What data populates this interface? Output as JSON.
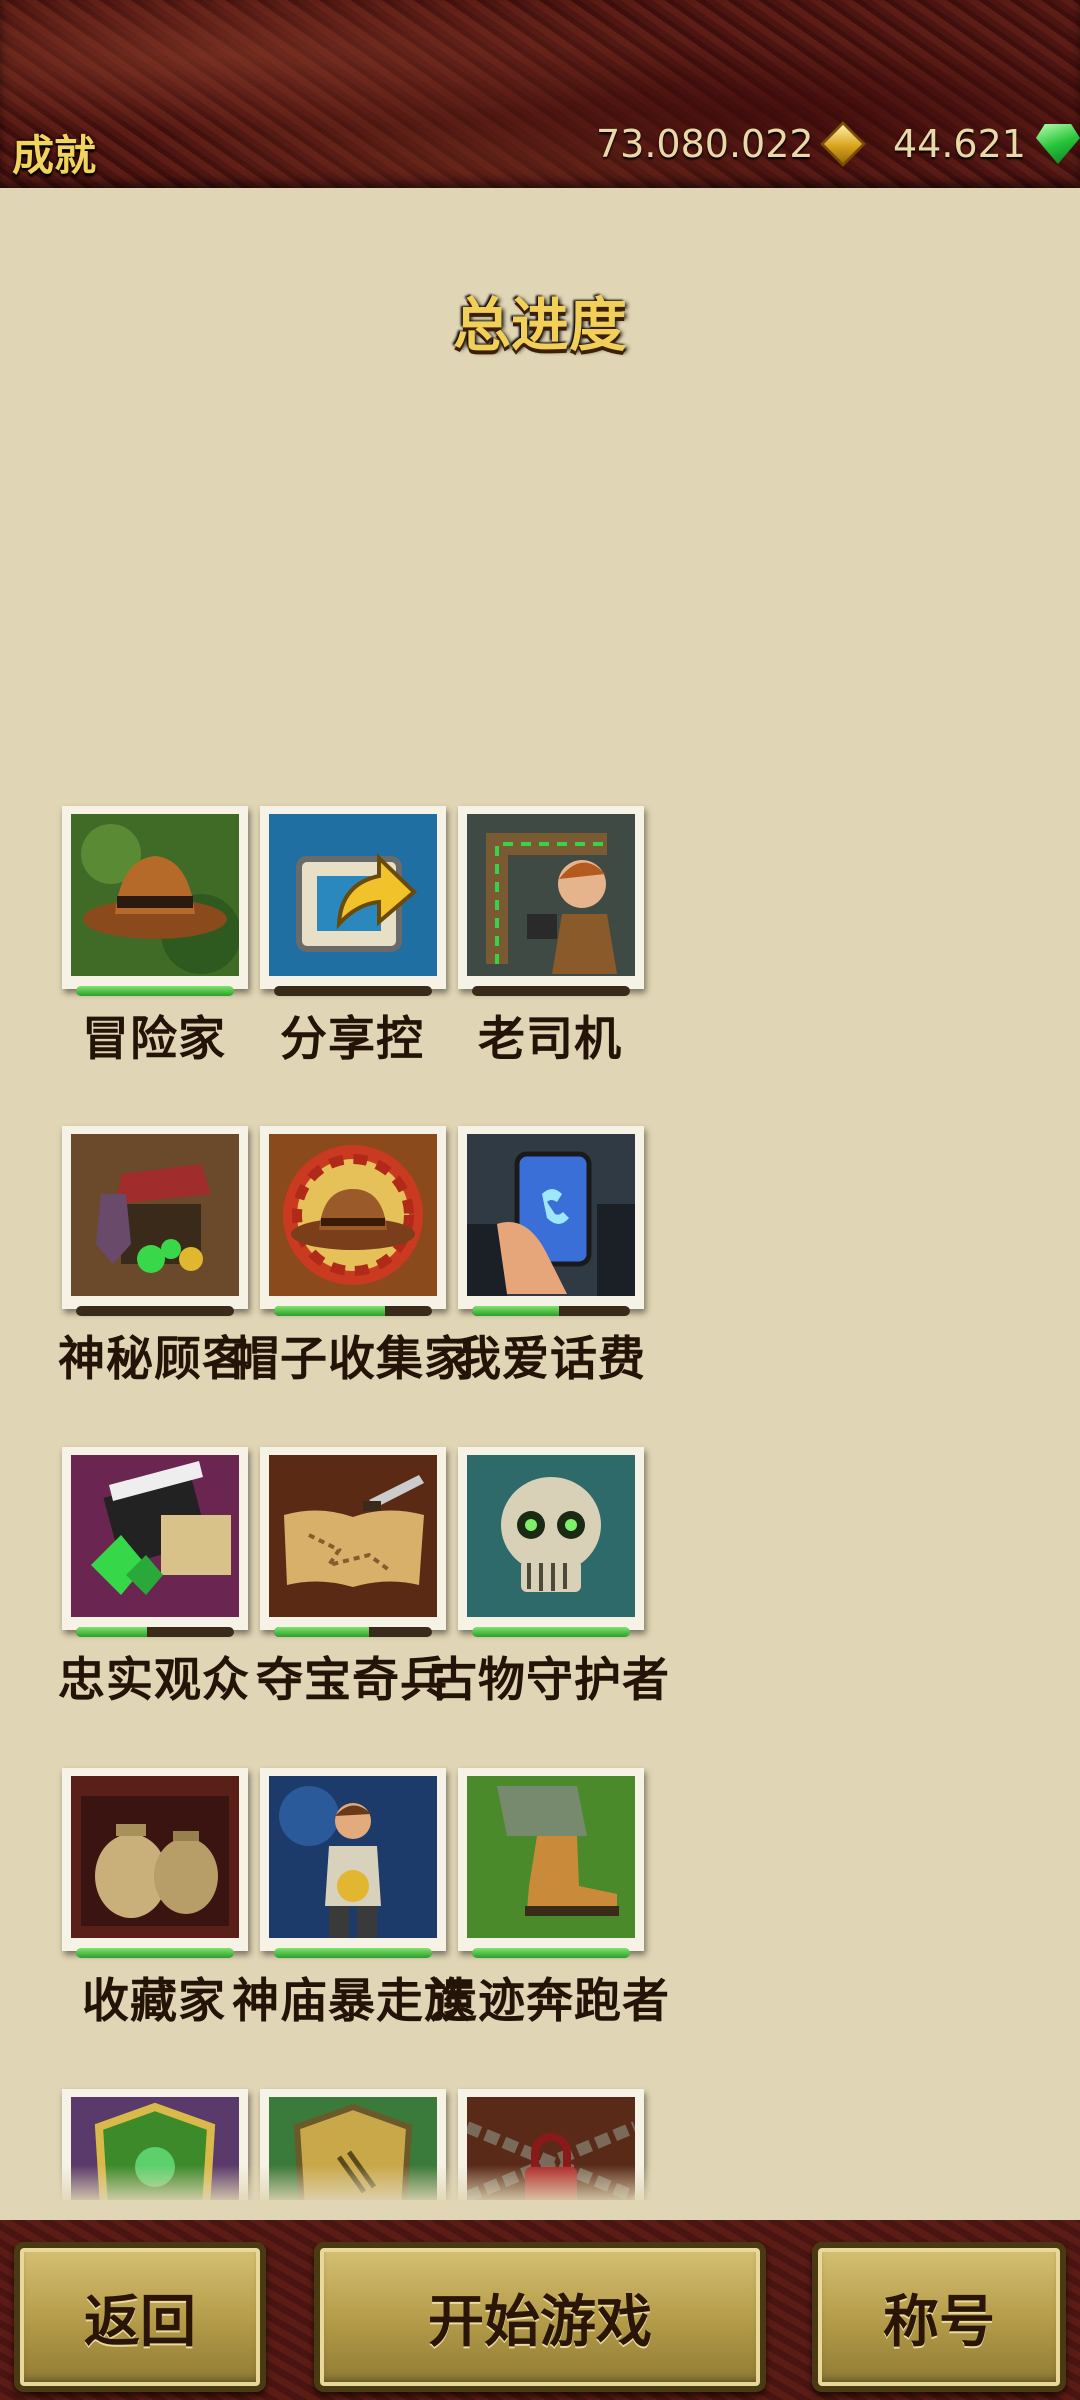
{
  "header": {
    "title": "成就",
    "coins": "73.080.022",
    "gems": "44.621",
    "coin_icon": "gold-diamond-coin-icon",
    "gem_icon": "green-gem-icon"
  },
  "progress_title": "总进度",
  "achievements": [
    {
      "label": "冒险家",
      "icon": "fedora-hat-icon",
      "progress": 1.0
    },
    {
      "label": "分享控",
      "icon": "share-arrow-icon",
      "progress": 0.0
    },
    {
      "label": "老司机",
      "icon": "runner-path-icon",
      "progress": 0.0
    },
    {
      "label": "神秘顾客",
      "icon": "treasure-shop-icon",
      "progress": 0.0
    },
    {
      "label": "帽子收集家",
      "icon": "cowboy-hat-icon",
      "progress": 0.7
    },
    {
      "label": "我爱话费",
      "icon": "phone-in-hand-icon",
      "progress": 0.55
    },
    {
      "label": "忠实观众",
      "icon": "clapperboard-gem-icon",
      "progress": 0.45
    },
    {
      "label": "夺宝奇兵",
      "icon": "treasure-map-icon",
      "progress": 0.6
    },
    {
      "label": "古物守护者",
      "icon": "skull-icon",
      "progress": 1.0
    },
    {
      "label": "收藏家",
      "icon": "golden-urns-icon",
      "progress": 1.0
    },
    {
      "label": "神庙暴走族",
      "icon": "explorer-running-icon",
      "progress": 1.0
    },
    {
      "label": "遗迹奔跑者",
      "icon": "running-boot-icon",
      "progress": 1.0
    },
    {
      "label": "",
      "icon": "green-shield-icon",
      "progress": 0.0
    },
    {
      "label": "",
      "icon": "scratched-shield-icon",
      "progress": 0.0
    },
    {
      "label": "",
      "icon": "chained-lock-icon",
      "progress": 0.0
    }
  ],
  "buttons": {
    "back": "返回",
    "start": "开始游戏",
    "titles": "称号"
  },
  "colors": {
    "accent_gold": "#f1cf58",
    "progress_green": "#4cc23f",
    "background": "#e0d5b4",
    "header_maroon": "#4d1512"
  }
}
